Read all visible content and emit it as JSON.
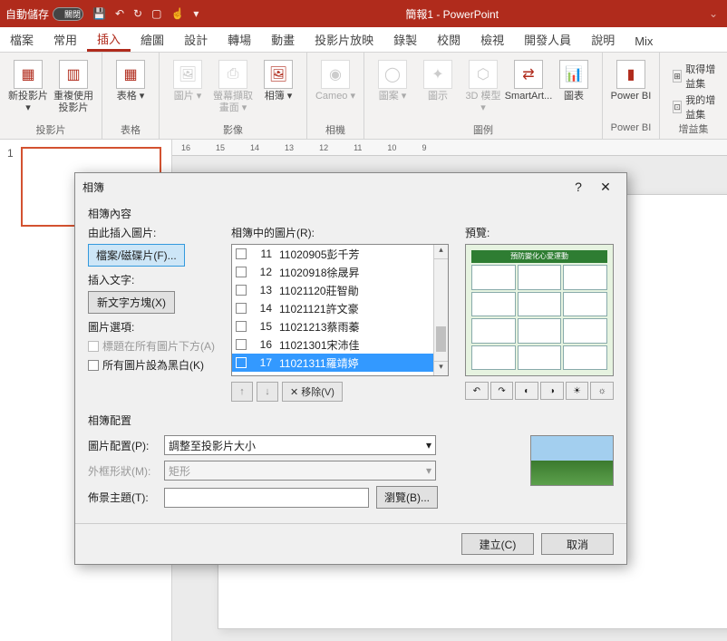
{
  "titlebar": {
    "autosave_label": "自動儲存",
    "autosave_state": "關閉",
    "doc_title": "簡報1 - PowerPoint"
  },
  "tabs": {
    "items": [
      "檔案",
      "常用",
      "插入",
      "繪圖",
      "設計",
      "轉場",
      "動畫",
      "投影片放映",
      "錄製",
      "校閱",
      "檢視",
      "開發人員",
      "說明",
      "Mix"
    ],
    "active_index": 2
  },
  "ribbon": {
    "groups": {
      "slide": {
        "new_slide": "新投影片 ▾",
        "reuse": "重複使用投影片",
        "label": "投影片"
      },
      "table": {
        "table": "表格 ▾",
        "label": "表格"
      },
      "image": {
        "picture": "圖片 ▾",
        "screenshot": "螢幕擷取畫面 ▾",
        "album": "相簿 ▾",
        "label": "影像"
      },
      "camera": {
        "cameo": "Cameo ▾",
        "label": "相機"
      },
      "illus": {
        "shapes": "圖案 ▾",
        "icons": "圖示",
        "model3d": "3D 模型 ▾",
        "smartart": "SmartArt...",
        "chart": "圖表",
        "label": "圖例"
      },
      "pbi": {
        "pbi": "Power BI",
        "label": "Power BI"
      },
      "addin": {
        "get": "取得增益集",
        "my": "我的增益集",
        "label": "增益集"
      }
    }
  },
  "thumbs": {
    "num": "1"
  },
  "ruler": [
    "16",
    "15",
    "14",
    "13",
    "12",
    "11",
    "10",
    "9"
  ],
  "dialog": {
    "title": "相簿",
    "content_title": "相簿內容",
    "insert_from_label": "由此插入圖片:",
    "file_disk_btn": "檔案/磁碟片(F)...",
    "insert_text_label": "插入文字:",
    "textbox_btn": "新文字方塊(X)",
    "pic_options_label": "圖片選項:",
    "caption_below": "標題在所有圖片下方(A)",
    "all_bw": "所有圖片設為黑白(K)",
    "list_label": "相簿中的圖片(R):",
    "list_items": [
      {
        "n": "11",
        "t": "11020905彭千芳"
      },
      {
        "n": "12",
        "t": "11020918徐晟昇"
      },
      {
        "n": "13",
        "t": "11021120莊智勛"
      },
      {
        "n": "14",
        "t": "11021121許文豪"
      },
      {
        "n": "15",
        "t": "11021213蔡雨蓁"
      },
      {
        "n": "16",
        "t": "11021301宋沛佳"
      },
      {
        "n": "17",
        "t": "11021311羅靖婷"
      }
    ],
    "remove_btn": "✕ 移除(V)",
    "preview_label": "預覽:",
    "preview_title": "預防變化心愛運動",
    "layout_title": "相簿配置",
    "layout_label": "圖片配置(P):",
    "layout_value": "調整至投影片大小",
    "frame_label": "外框形狀(M):",
    "frame_value": "矩形",
    "theme_label": "佈景主題(T):",
    "browse_btn": "瀏覽(B)...",
    "create_btn": "建立(C)",
    "cancel_btn": "取消"
  }
}
